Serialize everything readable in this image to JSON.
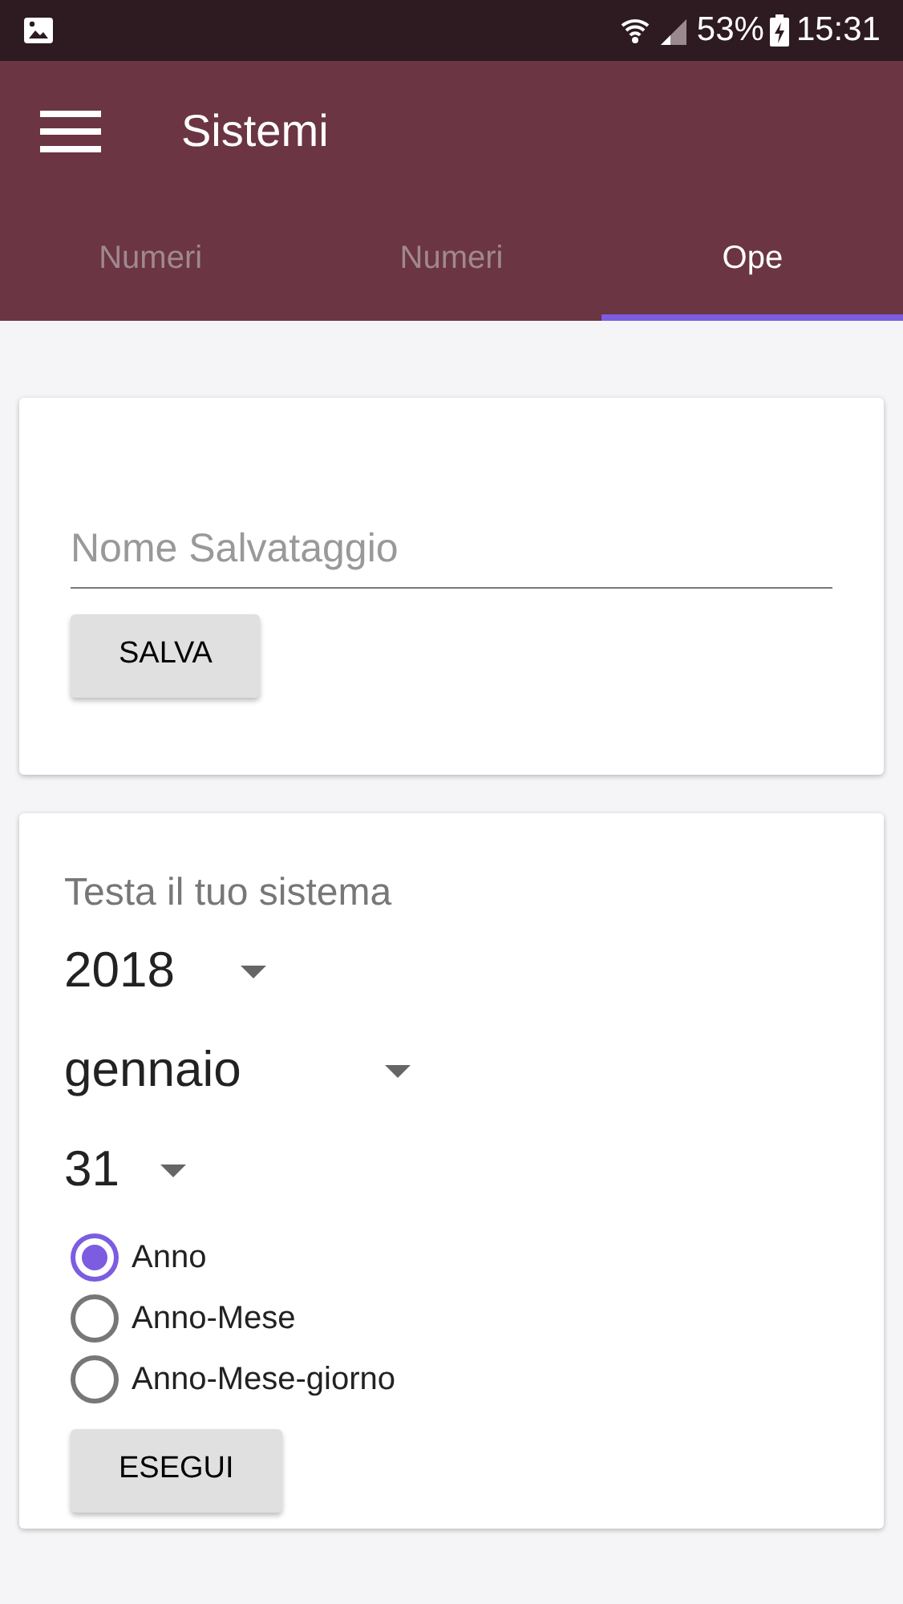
{
  "status_bar": {
    "battery": "53%",
    "time": "15:31"
  },
  "app_bar": {
    "title": "Sistemi"
  },
  "tabs": [
    {
      "label": "Numeri",
      "selected": false
    },
    {
      "label": "Numeri",
      "selected": false
    },
    {
      "label": "Ope",
      "selected": true
    }
  ],
  "save_card": {
    "placeholder": "Nome Salvataggio",
    "button": "SALVA"
  },
  "test_card": {
    "title": "Testa il tuo sistema",
    "dropdowns": [
      {
        "value": "2018"
      },
      {
        "value": "gennaio"
      },
      {
        "value": "31"
      }
    ],
    "options": [
      {
        "label": "Anno",
        "selected": true
      },
      {
        "label": "Anno-Mese",
        "selected": false
      },
      {
        "label": "Anno-Mese-giorno",
        "selected": false
      }
    ],
    "button": "ESEGUI"
  }
}
